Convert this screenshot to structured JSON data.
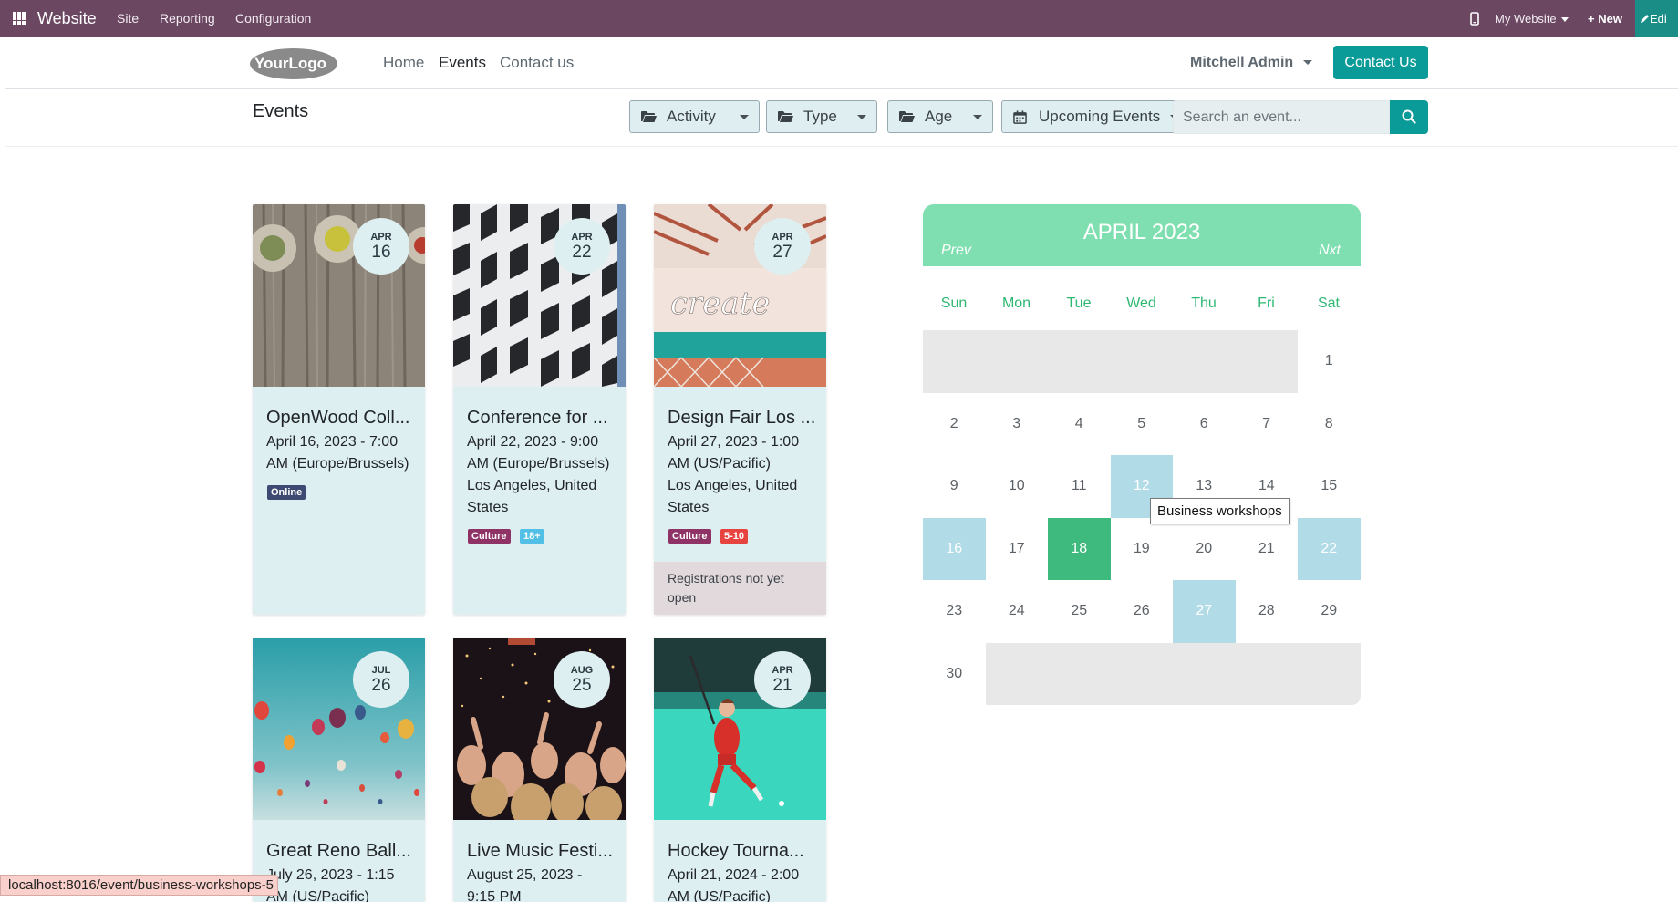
{
  "admin_bar": {
    "brand": "Website",
    "menu": [
      "Site",
      "Reporting",
      "Configuration"
    ],
    "website_switcher": "My Website",
    "new_label": "+ New",
    "edit_label": "Edi"
  },
  "header": {
    "logo_text": "YourLogo",
    "nav": [
      "Home",
      "Events",
      "Contact us"
    ],
    "active_nav": "Events",
    "user": "Mitchell Admin",
    "contact_button": "Contact Us"
  },
  "filters": {
    "heading": "Events",
    "dropdowns": [
      "Activity",
      "Type",
      "Age",
      "Upcoming Events"
    ],
    "search_placeholder": "Search an event..."
  },
  "events": [
    {
      "month": "APR",
      "day": "16",
      "title": "OpenWood Coll...",
      "date_lines": [
        "April 16, 2023 - 7:00",
        "AM (Europe/Brussels)"
      ],
      "location_lines": [],
      "tags": [
        {
          "label": "Online",
          "color": "#3f4a72"
        }
      ],
      "notice": ""
    },
    {
      "month": "APR",
      "day": "22",
      "title": "Conference for ...",
      "date_lines": [
        "April 22, 2023 - 9:00",
        "AM (Europe/Brussels)"
      ],
      "location_lines": [
        "Los Angeles, United",
        "States"
      ],
      "tags": [
        {
          "label": "Culture",
          "color": "#8f3265"
        },
        {
          "label": "18+",
          "color": "#52c0e6"
        }
      ],
      "notice": ""
    },
    {
      "month": "APR",
      "day": "27",
      "title": "Design Fair Los ...",
      "date_lines": [
        "April 27, 2023 - 1:00",
        "AM (US/Pacific)"
      ],
      "location_lines": [
        "Los Angeles, United",
        "States"
      ],
      "tags": [
        {
          "label": "Culture",
          "color": "#8f3265"
        },
        {
          "label": "5-10",
          "color": "#e8443f"
        }
      ],
      "notice": "Registrations not yet open"
    },
    {
      "month": "JUL",
      "day": "26",
      "title": "Great Reno Ball...",
      "date_lines": [
        "July 26, 2023 - 1:15",
        "AM (US/Pacific)"
      ],
      "location_lines": [],
      "tags": [],
      "notice": ""
    },
    {
      "month": "AUG",
      "day": "25",
      "title": "Live Music Festi...",
      "date_lines": [
        "August 25, 2023 -",
        "9:15 PM"
      ],
      "location_lines": [],
      "tags": [],
      "notice": ""
    },
    {
      "month": "APR",
      "day": "21",
      "title": "Hockey Tourna...",
      "date_lines": [
        "April 21, 2024 - 2:00",
        "AM (US/Pacific)"
      ],
      "location_lines": [],
      "tags": [],
      "notice": ""
    }
  ],
  "calendar": {
    "title": "APRIL 2023",
    "prev": "Prev",
    "next": "Nxt",
    "weekdays": [
      "Sun",
      "Mon",
      "Tue",
      "Wed",
      "Thu",
      "Fri",
      "Sat"
    ],
    "first_weekday_index": 6,
    "days_in_month": 30,
    "event_days": [
      12,
      16,
      22,
      27
    ],
    "today": 18,
    "tooltip": "Business workshops"
  },
  "status_bar": "localhost:8016/event/business-workshops-5"
}
